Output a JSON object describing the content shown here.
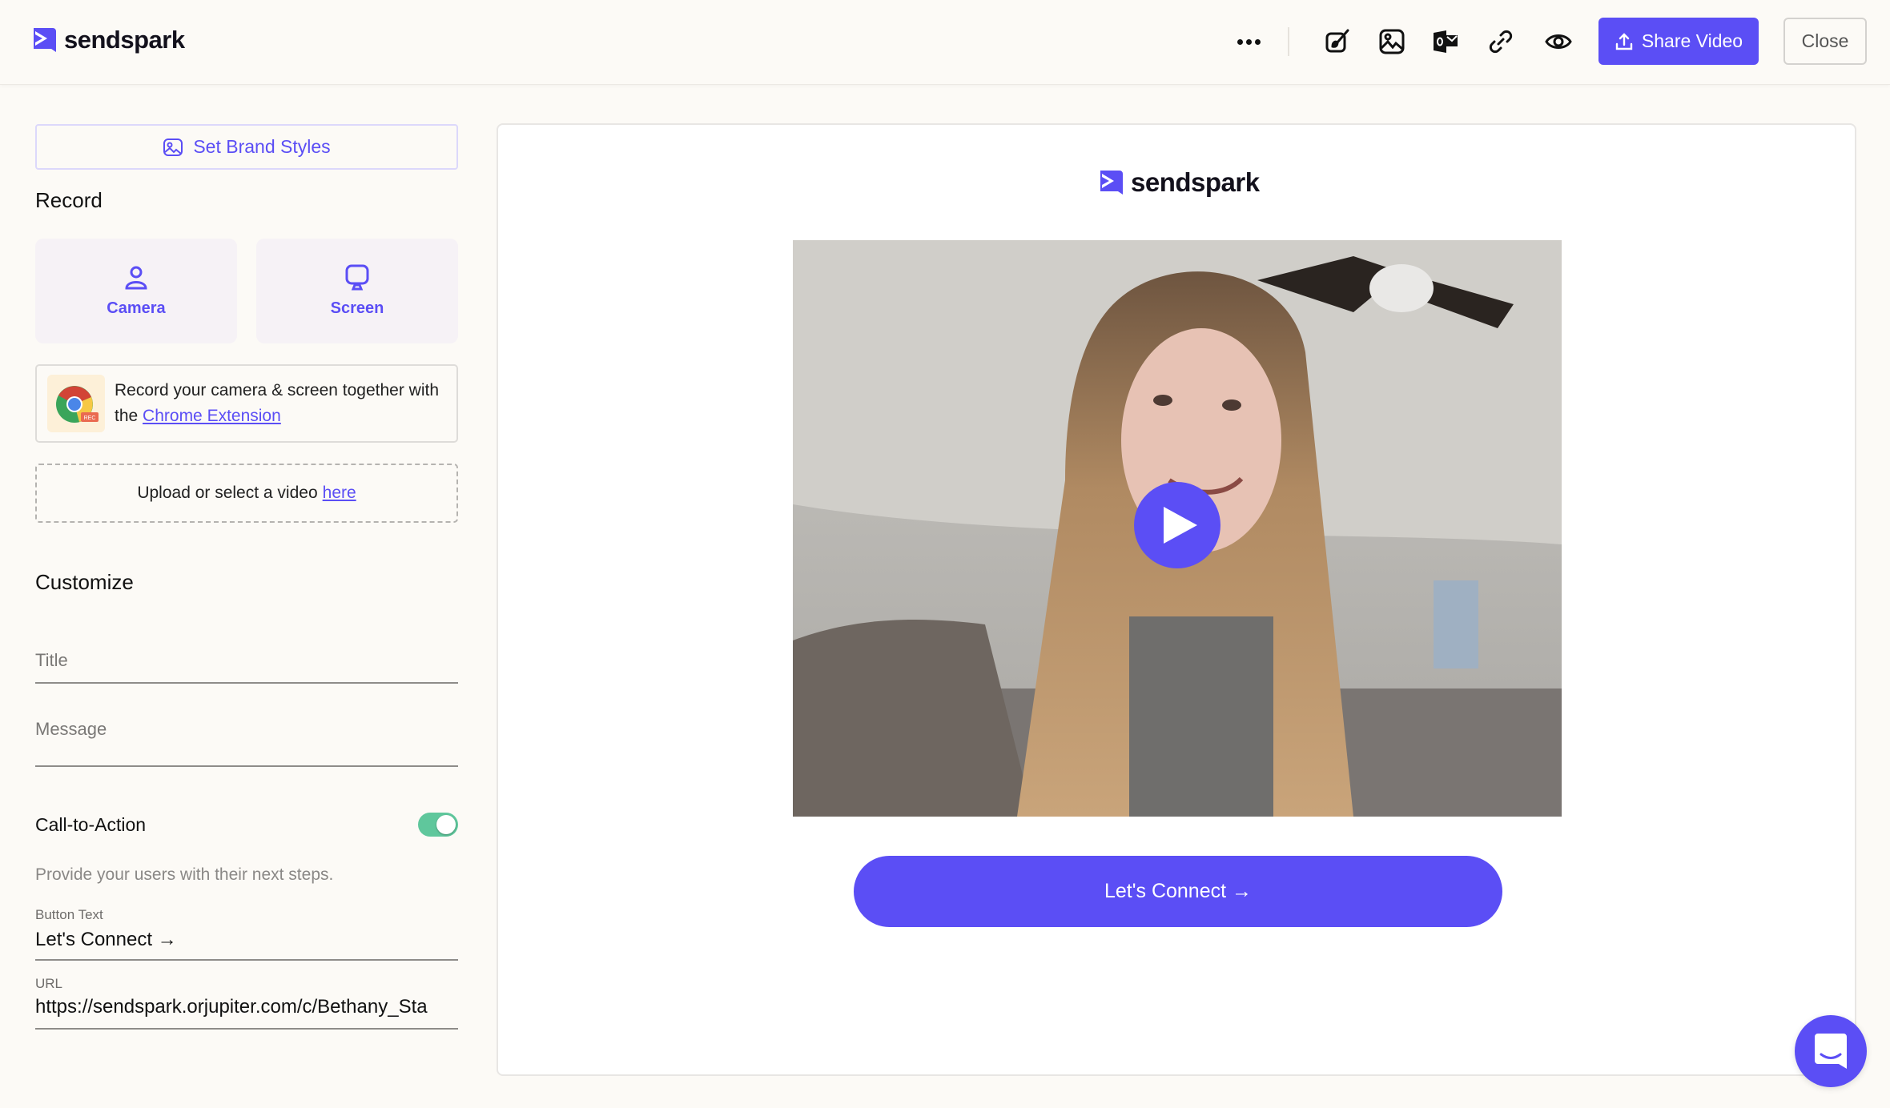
{
  "header": {
    "brand": "sendspark",
    "more_label": "More options",
    "tools": [
      {
        "name": "brush-icon",
        "label": "Edit style"
      },
      {
        "name": "image-icon",
        "label": "Thumbnail"
      },
      {
        "name": "outlook-icon",
        "label": "Outlook"
      },
      {
        "name": "link-icon",
        "label": "Copy link"
      },
      {
        "name": "eye-icon",
        "label": "Preview"
      }
    ],
    "share_label": "Share Video",
    "close_label": "Close"
  },
  "sidebar": {
    "brand_styles_label": "Set Brand Styles",
    "record_heading": "Record",
    "record_options": [
      {
        "label": "Camera",
        "icon": "person-icon"
      },
      {
        "label": "Screen",
        "icon": "monitor-icon"
      }
    ],
    "chrome": {
      "text_before": "Record your camera & screen together with the",
      "link": "Chrome Extension",
      "badge": "REC"
    },
    "upload": {
      "text": "Upload or select a video",
      "link": "here"
    },
    "customize_heading": "Customize",
    "title_placeholder": "Title",
    "message_placeholder": "Message",
    "cta": {
      "label": "Call-to-Action",
      "enabled": true,
      "helper": "Provide your users with their next steps.",
      "button_text_label": "Button Text",
      "button_text_value": "Let's Connect →",
      "url_label": "URL",
      "url_value": "https://sendspark.orjupiter.com/c/Bethany_Sta"
    }
  },
  "preview": {
    "brand": "sendspark",
    "cta_label": "Let's Connect →"
  },
  "colors": {
    "accent": "#5b4ef5",
    "toggle_on": "#5fc79c",
    "background": "#fcfaf6"
  }
}
